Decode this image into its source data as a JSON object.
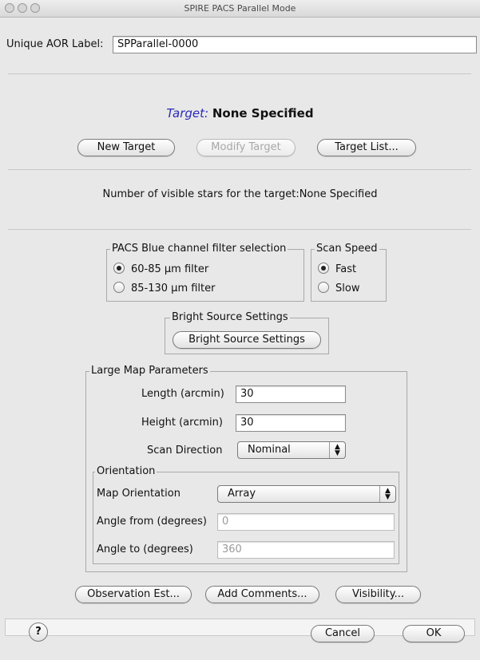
{
  "window": {
    "title": "SPIRE PACS Parallel Mode"
  },
  "aor": {
    "label": "Unique AOR Label:",
    "value": "SPParallel-0000"
  },
  "target": {
    "prefix": "Target:",
    "value": "None Specified",
    "prefix_color": "#2a2ab8"
  },
  "target_buttons": {
    "new": "New Target",
    "modify": "Modify Target",
    "list": "Target List..."
  },
  "visible_stars": "Number of visible stars for the target:None Specified",
  "pacs_filter": {
    "title": "PACS Blue channel filter selection",
    "options": [
      "60-85 µm filter",
      "85-130 µm filter"
    ],
    "selected": "60-85 µm filter"
  },
  "scan_speed": {
    "title": "Scan Speed",
    "options": [
      "Fast",
      "Slow"
    ],
    "selected": "Fast"
  },
  "bright_source": {
    "title": "Bright Source Settings",
    "button": "Bright Source Settings"
  },
  "large_map": {
    "title": "Large Map Parameters",
    "length_label": "Length (arcmin)",
    "length_value": "30",
    "height_label": "Height (arcmin)",
    "height_value": "30",
    "scan_direction_label": "Scan Direction",
    "scan_direction_value": "Nominal"
  },
  "orientation": {
    "title": "Orientation",
    "map_orientation_label": "Map Orientation",
    "map_orientation_value": "Array",
    "angle_from_label": "Angle from (degrees)",
    "angle_from_value": "0",
    "angle_to_label": "Angle to (degrees)",
    "angle_to_value": "360"
  },
  "bottom_buttons": {
    "observation": "Observation Est...",
    "comments": "Add Comments...",
    "visibility": "Visibility..."
  },
  "footer": {
    "help": "?",
    "cancel": "Cancel",
    "ok": "OK"
  },
  "icons": {
    "help": "help-icon",
    "select_arrows": "updown-arrows-icon"
  }
}
